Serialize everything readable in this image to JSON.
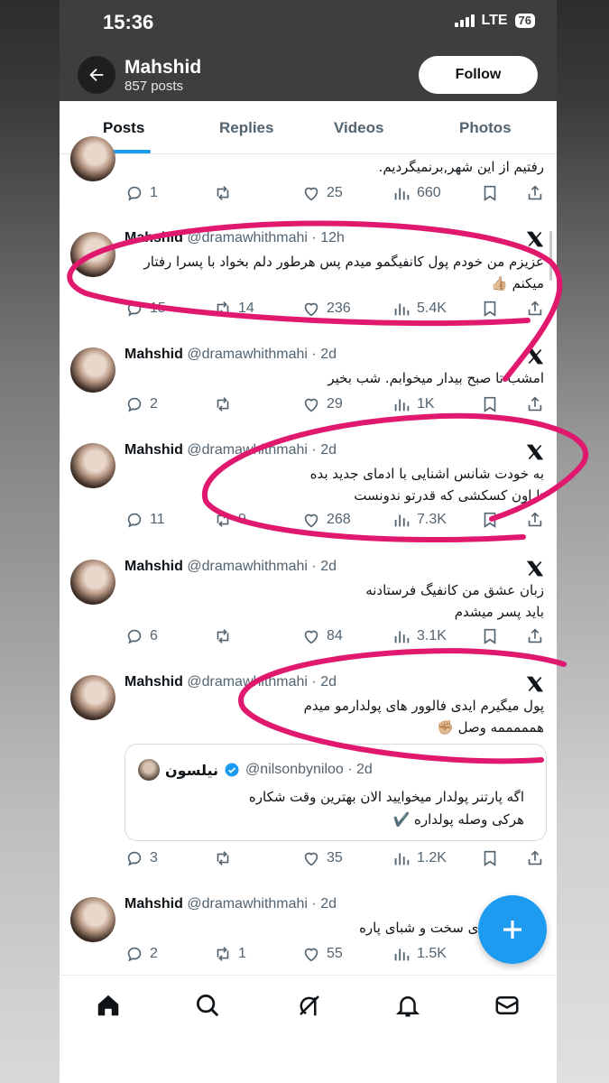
{
  "status_bar": {
    "time": "15:36",
    "network": "LTE",
    "battery": "76"
  },
  "profile": {
    "name": "Mahshid",
    "post_count": "857 posts",
    "follow_label": "Follow"
  },
  "tabs": [
    {
      "label": "Posts",
      "active": true
    },
    {
      "label": "Replies",
      "active": false
    },
    {
      "label": "Videos",
      "active": false
    },
    {
      "label": "Photos",
      "active": false
    }
  ],
  "tweets": [
    {
      "text": "رفتیم از این شهر,برنمیگردیم.",
      "replies": "1",
      "retweets": "",
      "likes": "25",
      "views": "660"
    },
    {
      "name": "Mahshid",
      "handle": "@dramawhithmahi · 12h",
      "text_lines": [
        "عزیزم من خودم پول کانفیگمو میدم پس هرطور دلم بخواد با پسرا رفتار",
        "میکنم 👍🏼"
      ],
      "replies": "15",
      "retweets": "14",
      "likes": "236",
      "views": "5.4K"
    },
    {
      "name": "Mahshid",
      "handle": "@dramawhithmahi · 2d",
      "text_lines": [
        "امشب تا صبح بیدار میخوابم. شب بخیر"
      ],
      "replies": "2",
      "retweets": "",
      "likes": "29",
      "views": "1K"
    },
    {
      "name": "Mahshid",
      "handle": "@dramawhithmahi · 2d",
      "text_lines": [
        "به خودت شانس اشنایی با ادمای جدید بده",
        "تا اون کسکشی که قدرتو ندونست"
      ],
      "replies": "11",
      "retweets": "9",
      "likes": "268",
      "views": "7.3K"
    },
    {
      "name": "Mahshid",
      "handle": "@dramawhithmahi · 2d",
      "text_lines": [
        "زبان عشق من کانفیگ فرستادنه",
        "باید پسر میشدم"
      ],
      "replies": "6",
      "retweets": "",
      "likes": "84",
      "views": "3.1K"
    },
    {
      "name": "Mahshid",
      "handle": "@dramawhithmahi · 2d",
      "text_lines": [
        "پول میگیرم ایدی فالوور های پولدارمو میدم",
        "همممممه وصل ✊🏼"
      ],
      "replies": "3",
      "retweets": "",
      "likes": "35",
      "views": "1.2K",
      "quote": {
        "name": "نیلسون",
        "handle": "@nilsonbyniloo · 2d",
        "text_lines": [
          "اگه پارتنر پولدار میخوایید الان بهترین وقت شکاره",
          "هرکی وصله پولداره ✔️"
        ]
      }
    },
    {
      "name": "Mahshid",
      "handle": "@dramawhithmahi · 2d",
      "text_lines": [
        "برای سخت و شبای پاره"
      ],
      "replies": "2",
      "retweets": "1",
      "likes": "55",
      "views": "1.5K"
    }
  ],
  "nav": [
    "home-icon",
    "search-icon",
    "grok-icon",
    "notifications-icon",
    "messages-icon"
  ],
  "colors": {
    "accent": "#1d9bf0",
    "annotation": "#e0196f",
    "text_secondary": "#536471"
  }
}
